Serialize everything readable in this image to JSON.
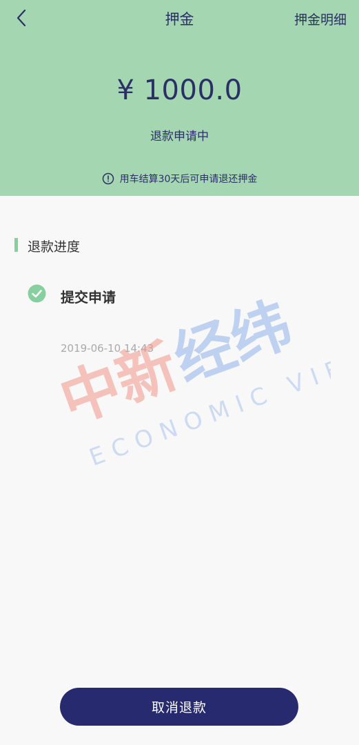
{
  "header": {
    "title": "押金",
    "detail_link": "押金明细",
    "amount": "¥ 1000.0",
    "status": "退款申请中",
    "notice": "用车结算30天后可申请退还押金"
  },
  "progress": {
    "section_title": "退款进度",
    "steps": [
      {
        "label": "提交申请",
        "time": "2019-06-10 14:43"
      }
    ]
  },
  "watermark": {
    "cn_text": "中新经纬",
    "en_text": "ECONOMIC VIEW"
  },
  "footer": {
    "cancel_label": "取消退款"
  },
  "colors": {
    "header_bg": "#a4d6b1",
    "primary": "#2a2f66",
    "button_bg": "#272a6e",
    "accent_green": "#86cf9e"
  }
}
